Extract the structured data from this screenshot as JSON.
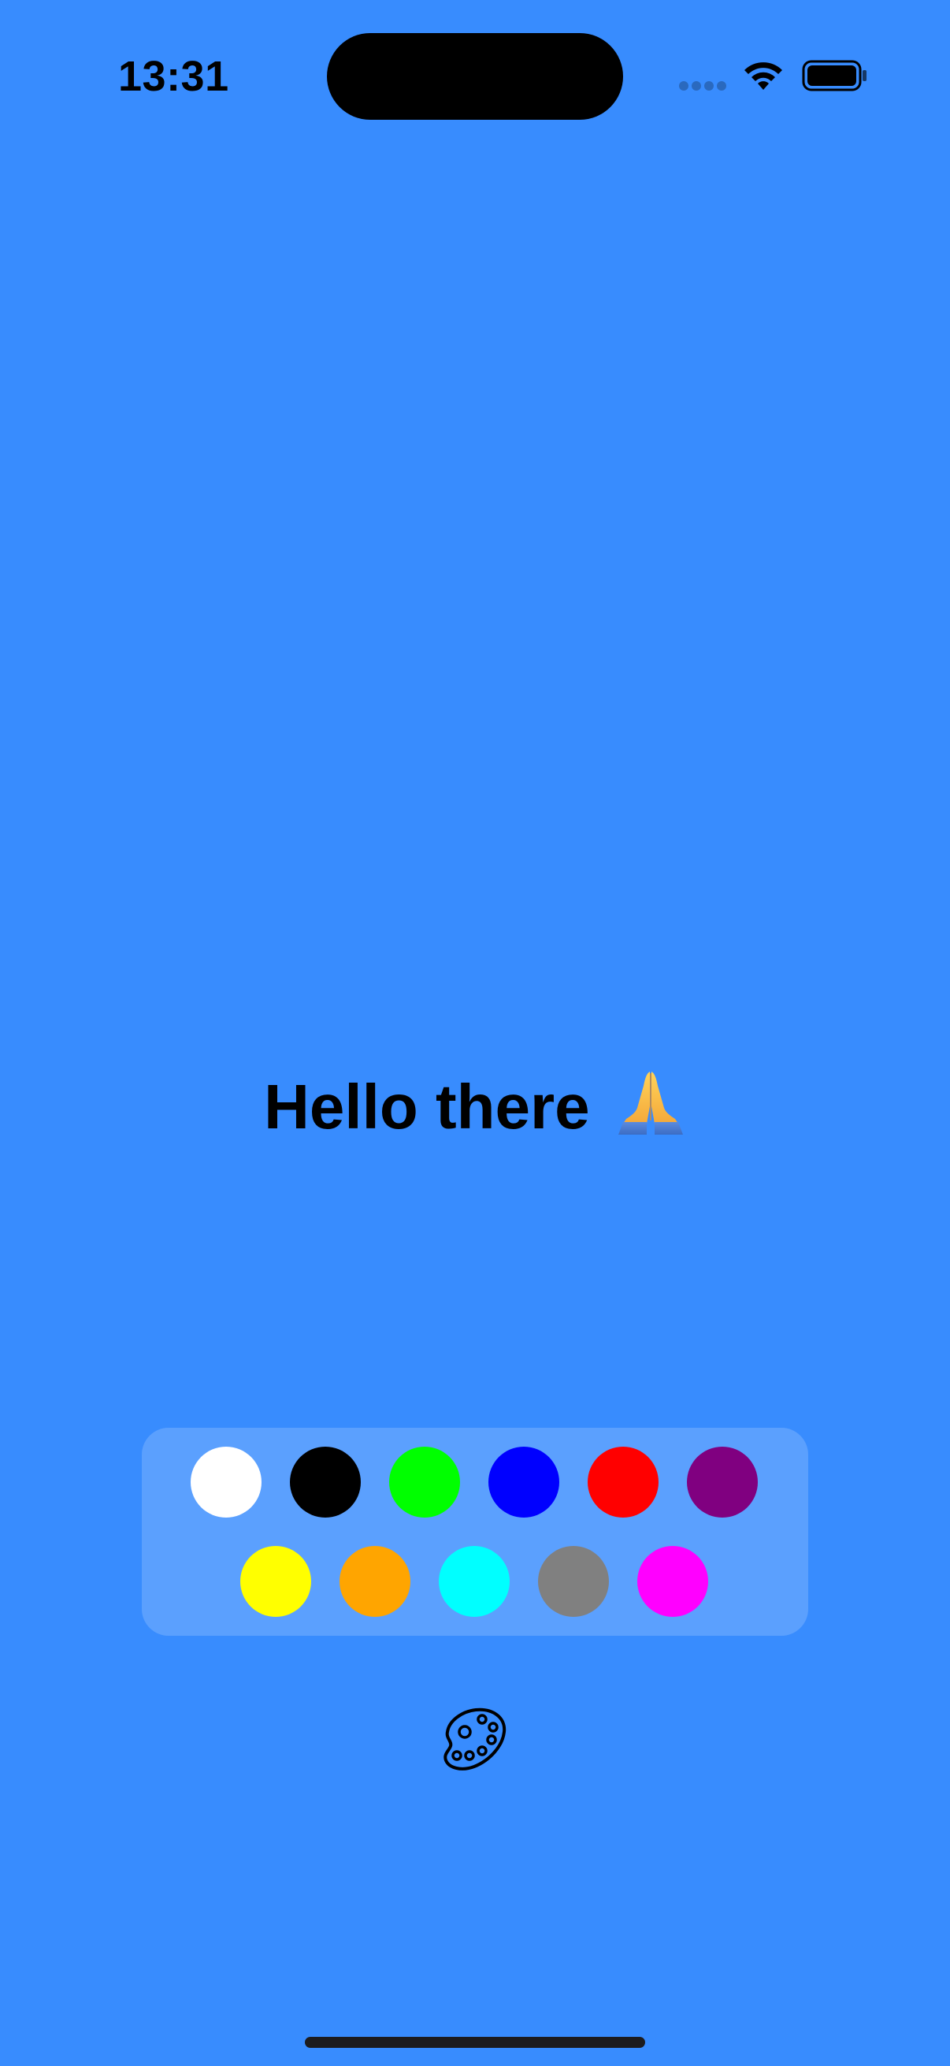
{
  "status_bar": {
    "time": "13:31"
  },
  "main": {
    "greeting": "Hello there",
    "greeting_emoji": "folded-hands-emoji"
  },
  "palette": {
    "row1": [
      {
        "name": "white",
        "color": "#FFFFFF"
      },
      {
        "name": "black",
        "color": "#000000"
      },
      {
        "name": "green",
        "color": "#00FF00"
      },
      {
        "name": "blue",
        "color": "#0000FF"
      },
      {
        "name": "red",
        "color": "#FF0000"
      },
      {
        "name": "purple",
        "color": "#800080"
      }
    ],
    "row2": [
      {
        "name": "yellow",
        "color": "#FFFF00"
      },
      {
        "name": "orange",
        "color": "#FFA500"
      },
      {
        "name": "cyan",
        "color": "#00FFFF"
      },
      {
        "name": "gray",
        "color": "#808080"
      },
      {
        "name": "magenta",
        "color": "#FF00FF"
      }
    ],
    "toggle_icon": "paint-palette-icon"
  },
  "colors": {
    "background": "#388CFE",
    "panel": "rgba(255,255,255,0.18)"
  }
}
